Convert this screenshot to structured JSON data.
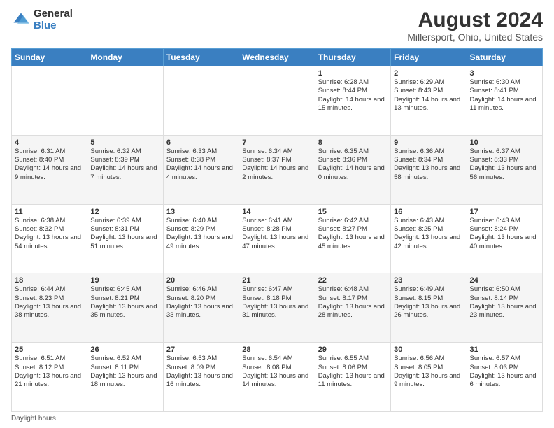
{
  "header": {
    "logo_general": "General",
    "logo_blue": "Blue",
    "title": "August 2024",
    "subtitle": "Millersport, Ohio, United States"
  },
  "days_of_week": [
    "Sunday",
    "Monday",
    "Tuesday",
    "Wednesday",
    "Thursday",
    "Friday",
    "Saturday"
  ],
  "weeks": [
    [
      {
        "day": "",
        "text": ""
      },
      {
        "day": "",
        "text": ""
      },
      {
        "day": "",
        "text": ""
      },
      {
        "day": "",
        "text": ""
      },
      {
        "day": "1",
        "text": "Sunrise: 6:28 AM\nSunset: 8:44 PM\nDaylight: 14 hours and 15 minutes."
      },
      {
        "day": "2",
        "text": "Sunrise: 6:29 AM\nSunset: 8:43 PM\nDaylight: 14 hours and 13 minutes."
      },
      {
        "day": "3",
        "text": "Sunrise: 6:30 AM\nSunset: 8:41 PM\nDaylight: 14 hours and 11 minutes."
      }
    ],
    [
      {
        "day": "4",
        "text": "Sunrise: 6:31 AM\nSunset: 8:40 PM\nDaylight: 14 hours and 9 minutes."
      },
      {
        "day": "5",
        "text": "Sunrise: 6:32 AM\nSunset: 8:39 PM\nDaylight: 14 hours and 7 minutes."
      },
      {
        "day": "6",
        "text": "Sunrise: 6:33 AM\nSunset: 8:38 PM\nDaylight: 14 hours and 4 minutes."
      },
      {
        "day": "7",
        "text": "Sunrise: 6:34 AM\nSunset: 8:37 PM\nDaylight: 14 hours and 2 minutes."
      },
      {
        "day": "8",
        "text": "Sunrise: 6:35 AM\nSunset: 8:36 PM\nDaylight: 14 hours and 0 minutes."
      },
      {
        "day": "9",
        "text": "Sunrise: 6:36 AM\nSunset: 8:34 PM\nDaylight: 13 hours and 58 minutes."
      },
      {
        "day": "10",
        "text": "Sunrise: 6:37 AM\nSunset: 8:33 PM\nDaylight: 13 hours and 56 minutes."
      }
    ],
    [
      {
        "day": "11",
        "text": "Sunrise: 6:38 AM\nSunset: 8:32 PM\nDaylight: 13 hours and 54 minutes."
      },
      {
        "day": "12",
        "text": "Sunrise: 6:39 AM\nSunset: 8:31 PM\nDaylight: 13 hours and 51 minutes."
      },
      {
        "day": "13",
        "text": "Sunrise: 6:40 AM\nSunset: 8:29 PM\nDaylight: 13 hours and 49 minutes."
      },
      {
        "day": "14",
        "text": "Sunrise: 6:41 AM\nSunset: 8:28 PM\nDaylight: 13 hours and 47 minutes."
      },
      {
        "day": "15",
        "text": "Sunrise: 6:42 AM\nSunset: 8:27 PM\nDaylight: 13 hours and 45 minutes."
      },
      {
        "day": "16",
        "text": "Sunrise: 6:43 AM\nSunset: 8:25 PM\nDaylight: 13 hours and 42 minutes."
      },
      {
        "day": "17",
        "text": "Sunrise: 6:43 AM\nSunset: 8:24 PM\nDaylight: 13 hours and 40 minutes."
      }
    ],
    [
      {
        "day": "18",
        "text": "Sunrise: 6:44 AM\nSunset: 8:23 PM\nDaylight: 13 hours and 38 minutes."
      },
      {
        "day": "19",
        "text": "Sunrise: 6:45 AM\nSunset: 8:21 PM\nDaylight: 13 hours and 35 minutes."
      },
      {
        "day": "20",
        "text": "Sunrise: 6:46 AM\nSunset: 8:20 PM\nDaylight: 13 hours and 33 minutes."
      },
      {
        "day": "21",
        "text": "Sunrise: 6:47 AM\nSunset: 8:18 PM\nDaylight: 13 hours and 31 minutes."
      },
      {
        "day": "22",
        "text": "Sunrise: 6:48 AM\nSunset: 8:17 PM\nDaylight: 13 hours and 28 minutes."
      },
      {
        "day": "23",
        "text": "Sunrise: 6:49 AM\nSunset: 8:15 PM\nDaylight: 13 hours and 26 minutes."
      },
      {
        "day": "24",
        "text": "Sunrise: 6:50 AM\nSunset: 8:14 PM\nDaylight: 13 hours and 23 minutes."
      }
    ],
    [
      {
        "day": "25",
        "text": "Sunrise: 6:51 AM\nSunset: 8:12 PM\nDaylight: 13 hours and 21 minutes."
      },
      {
        "day": "26",
        "text": "Sunrise: 6:52 AM\nSunset: 8:11 PM\nDaylight: 13 hours and 18 minutes."
      },
      {
        "day": "27",
        "text": "Sunrise: 6:53 AM\nSunset: 8:09 PM\nDaylight: 13 hours and 16 minutes."
      },
      {
        "day": "28",
        "text": "Sunrise: 6:54 AM\nSunset: 8:08 PM\nDaylight: 13 hours and 14 minutes."
      },
      {
        "day": "29",
        "text": "Sunrise: 6:55 AM\nSunset: 8:06 PM\nDaylight: 13 hours and 11 minutes."
      },
      {
        "day": "30",
        "text": "Sunrise: 6:56 AM\nSunset: 8:05 PM\nDaylight: 13 hours and 9 minutes."
      },
      {
        "day": "31",
        "text": "Sunrise: 6:57 AM\nSunset: 8:03 PM\nDaylight: 13 hours and 6 minutes."
      }
    ]
  ],
  "footer": "Daylight hours"
}
